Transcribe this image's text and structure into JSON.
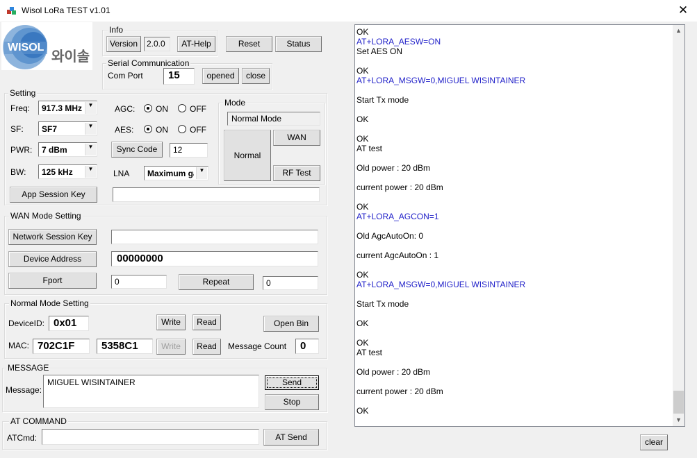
{
  "window": {
    "title": "Wisol LoRa TEST v1.01"
  },
  "logo": {
    "brand": "WISOL",
    "korean": "와이솔"
  },
  "info": {
    "group_label": "Info",
    "version_btn": "Version",
    "version_value": "2.0.0",
    "athelp_btn": "AT-Help"
  },
  "top_buttons": {
    "reset": "Reset",
    "status": "Status"
  },
  "serial": {
    "group_label": "Serial Communication",
    "port_label": "Com Port",
    "port_value": "15",
    "opened_btn": "opened",
    "close_btn": "close"
  },
  "setting": {
    "group_label": "Setting",
    "freq_label": "Freq:",
    "freq_value": "917.3 MHz",
    "sf_label": "SF:",
    "sf_value": "SF7",
    "pwr_label": "PWR:",
    "pwr_value": "7 dBm",
    "bw_label": "BW:",
    "bw_value": "125 kHz",
    "agc_label": "AGC:",
    "aes_label": "AES:",
    "on": "ON",
    "off": "OFF",
    "agc_state": "ON",
    "aes_state": "ON",
    "sync_btn": "Sync Code",
    "sync_value": "12",
    "lna_label": "LNA",
    "lna_value": "Maximum gain",
    "app_key_btn": "App Session Key",
    "app_key_value": ""
  },
  "mode": {
    "group_label": "Mode",
    "current": "Normal Mode",
    "normal_btn": "Normal",
    "wan_btn": "WAN",
    "rftest_btn": "RF Test"
  },
  "wan": {
    "group_label": "WAN Mode Setting",
    "nwk_key_btn": "Network Session Key",
    "nwk_key_value": "",
    "dev_addr_btn": "Device Address",
    "dev_addr_value": "00000000",
    "fport_btn": "Fport",
    "fport_value": "0",
    "repeat_btn": "Repeat",
    "repeat_value": "0"
  },
  "normal": {
    "group_label": "Normal Mode Setting",
    "device_id_label": "DeviceID:",
    "device_id_value": "0x01",
    "write_btn": "Write",
    "read_btn": "Read",
    "open_bin_btn": "Open Bin",
    "mac_label": "MAC:",
    "mac1": "702C1F",
    "mac2": "5358C1",
    "write2_btn": "Write",
    "read2_btn": "Read",
    "msg_count_label": "Message Count",
    "msg_count_value": "0"
  },
  "message": {
    "group_label": "MESSAGE",
    "label": "Message:",
    "value": "MIGUEL WISINTAINER",
    "send_btn": "Send",
    "stop_btn": "Stop"
  },
  "at": {
    "group_label": "AT COMMAND",
    "label": "ATCmd:",
    "value": "",
    "send_btn": "AT Send"
  },
  "log": {
    "lines": [
      {
        "t": "OK",
        "c": false
      },
      {
        "t": "AT+LORA_AESW=ON",
        "c": true
      },
      {
        "t": "Set AES ON",
        "c": false
      },
      {
        "t": "",
        "c": false
      },
      {
        "t": "OK",
        "c": false
      },
      {
        "t": "AT+LORA_MSGW=0,MIGUEL WISINTAINER",
        "c": true
      },
      {
        "t": "",
        "c": false
      },
      {
        "t": "Start Tx mode",
        "c": false
      },
      {
        "t": "",
        "c": false
      },
      {
        "t": "OK",
        "c": false
      },
      {
        "t": "",
        "c": false
      },
      {
        "t": "OK",
        "c": false
      },
      {
        "t": "AT test",
        "c": false
      },
      {
        "t": "",
        "c": false
      },
      {
        "t": "Old power : 20 dBm",
        "c": false
      },
      {
        "t": "",
        "c": false
      },
      {
        "t": "current power : 20 dBm",
        "c": false
      },
      {
        "t": "",
        "c": false
      },
      {
        "t": "OK",
        "c": false
      },
      {
        "t": "AT+LORA_AGCON=1",
        "c": true
      },
      {
        "t": "",
        "c": false
      },
      {
        "t": "Old AgcAutoOn: 0",
        "c": false
      },
      {
        "t": "",
        "c": false
      },
      {
        "t": "current AgcAutoOn : 1",
        "c": false
      },
      {
        "t": "",
        "c": false
      },
      {
        "t": "OK",
        "c": false
      },
      {
        "t": "AT+LORA_MSGW=0,MIGUEL WISINTAINER",
        "c": true
      },
      {
        "t": "",
        "c": false
      },
      {
        "t": "Start Tx mode",
        "c": false
      },
      {
        "t": "",
        "c": false
      },
      {
        "t": "OK",
        "c": false
      },
      {
        "t": "",
        "c": false
      },
      {
        "t": "OK",
        "c": false
      },
      {
        "t": "AT test",
        "c": false
      },
      {
        "t": "",
        "c": false
      },
      {
        "t": "Old power : 20 dBm",
        "c": false
      },
      {
        "t": "",
        "c": false
      },
      {
        "t": "current power : 20 dBm",
        "c": false
      },
      {
        "t": "",
        "c": false
      },
      {
        "t": "OK",
        "c": false
      }
    ],
    "clear_btn": "clear"
  },
  "colors": {
    "cmd_text": "#1e1ec8",
    "logo_blue": "#4a86c5"
  }
}
